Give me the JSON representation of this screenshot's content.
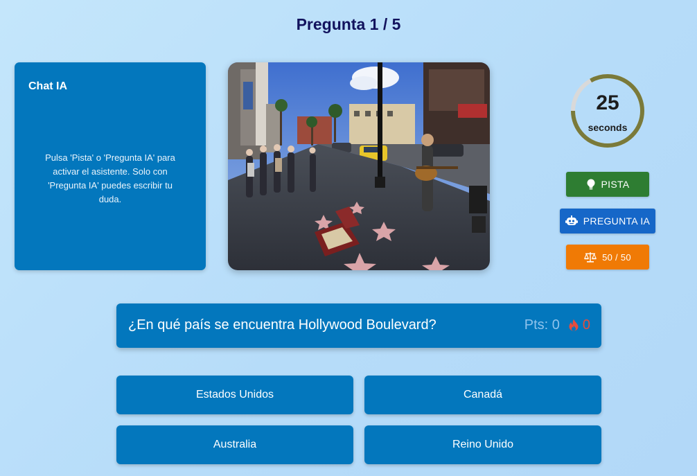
{
  "header": {
    "title": "Pregunta 1 / 5"
  },
  "chat": {
    "title": "Chat IA",
    "hint": "Pulsa 'Pista' o 'Pregunta IA' para activar el asistente. Solo con 'Pregunta IA' puedes escribir tu duda."
  },
  "timer": {
    "value": "25",
    "unit": "seconds",
    "remaining_fraction": 0.83,
    "ring_color": "#7a7a3a",
    "track_color": "#d9d9d9"
  },
  "buttons": {
    "hint_label": "PISTA",
    "ask_ai_label": "PREGUNTA IA",
    "fifty_label": "50 / 50",
    "hint_icon": "lightbulb-icon",
    "ask_ai_icon": "robot-icon",
    "fifty_icon": "scale-icon"
  },
  "question": {
    "text": "¿En qué país se encuentra Hollywood Boulevard?",
    "score_label": "Pts: 0",
    "streak": "0",
    "streak_icon": "fire-icon"
  },
  "answers": [
    "Estados Unidos",
    "Canadá",
    "Australia",
    "Reino Unido"
  ],
  "colors": {
    "panel": "#0377bd",
    "hint_button": "#2e7d32",
    "ai_button": "#1667c8",
    "fifty_button": "#f07a05",
    "title": "#12135e"
  }
}
